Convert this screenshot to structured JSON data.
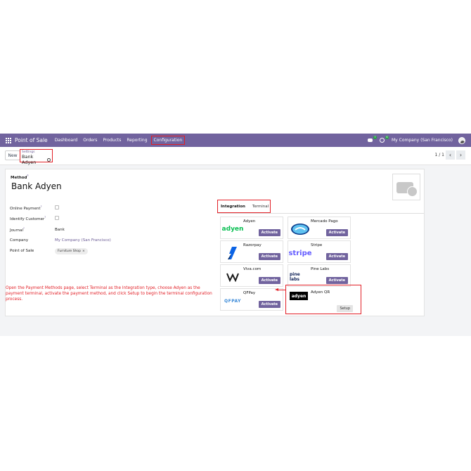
{
  "navbar": {
    "app_name": "Point of Sale",
    "menu": [
      "Dashboard",
      "Orders",
      "Products",
      "Reporting",
      "Configuration"
    ],
    "chat_badge": "7",
    "activity_badge": "6",
    "company": "My Company (San Francisco)"
  },
  "control": {
    "new_label": "New",
    "breadcrumb_parent": "Settings",
    "breadcrumb_current": "Bank Adyen",
    "pager": "1 / 1",
    "prev": "‹",
    "next": "›"
  },
  "form": {
    "method_label": "Method",
    "method_name": "Bank Adyen",
    "fields": {
      "online_payment": "Online Payment",
      "identify_customer": "Identify Customer",
      "journal_label": "Journal",
      "journal_value": "Bank",
      "company_label": "Company",
      "company_value": "My Company (San Francisco)",
      "pos_label": "Point of Sale",
      "pos_tag": "Furniture Shop"
    },
    "tabs": {
      "integration": "Integration",
      "terminal": "Terminal"
    }
  },
  "providers": [
    {
      "name": "Adyen",
      "logo": "adyen",
      "action": "Activate"
    },
    {
      "name": "Mercado Pago",
      "logo": "handshake-icon",
      "action": "Activate"
    },
    {
      "name": "Razorpay",
      "logo": "razorpay-icon",
      "action": "Activate"
    },
    {
      "name": "Stripe",
      "logo": "stripe",
      "action": "Activate"
    },
    {
      "name": "Viva.com",
      "logo": "viva-icon",
      "action": "Activate"
    },
    {
      "name": "Pine Labs",
      "logo": "pine labs",
      "action": "Activate"
    },
    {
      "name": "QFPay",
      "logo": "QFPAY",
      "action": "Activate"
    },
    {
      "name": "Adyen QR",
      "logo": "adyen",
      "action": "Setup"
    }
  ],
  "annotation": "Open the Payment Methods page, select Terminal as the Integration type, choose Adyen as the payment terminal, activate the payment method, and click Setup to begin the terminal configuration process.",
  "colors": {
    "brand": "#71639e",
    "highlight": "#e21f26",
    "adyen": "#0abf53",
    "stripe": "#635bff"
  }
}
